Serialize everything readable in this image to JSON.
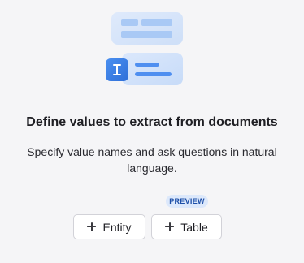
{
  "empty_state": {
    "title": "Define values to extract from documents",
    "subtitle": "Specify value names and ask questions in natural language.",
    "illustration_icon": "text-cursor-icon"
  },
  "actions": {
    "preview_badge": "PREVIEW",
    "entity_label": "Entity",
    "table_label": "Table",
    "add_icon": "plus-icon"
  },
  "colors": {
    "background": "#f5f5f7",
    "card_light": "#d6e5fb",
    "card_bar": "#9cc0f4",
    "accent_blue": "#3b7fe6",
    "badge_bg": "#dce8fb",
    "badge_text": "#1d4fa8"
  }
}
